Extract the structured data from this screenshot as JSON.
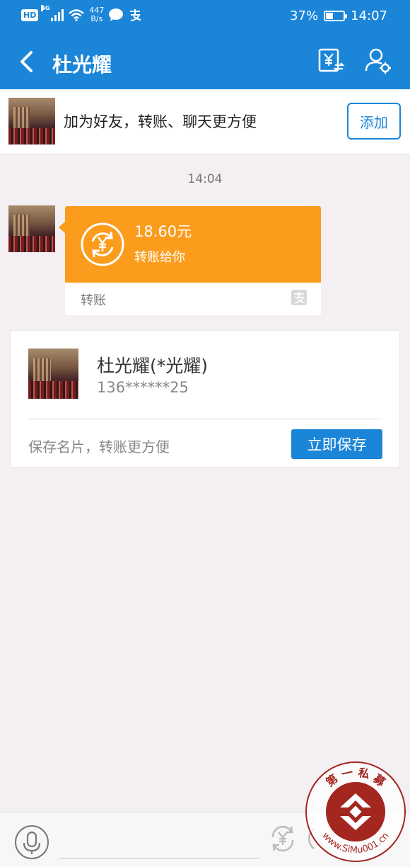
{
  "status_bar": {
    "hd": "HD",
    "network": "4G",
    "speed_value": "447",
    "speed_unit": "B/s",
    "battery": "37%",
    "battery_level": 0.37,
    "time": "14:07"
  },
  "nav": {
    "title": "杜光耀"
  },
  "friend_prompt": {
    "text": "加为好友，转账、聊天更方便",
    "add_label": "添加"
  },
  "chat": {
    "time": "14:04",
    "transfer": {
      "amount": "18.60元",
      "desc": "转账给你",
      "type": "转账"
    }
  },
  "contact_card": {
    "name": "杜光耀(*光耀)",
    "phone": "136******25",
    "hint": "保存名片，转账更方便",
    "save_label": "立即保存"
  },
  "input": {
    "placeholder": ""
  },
  "watermark": {
    "top_text": "第 一 私 募",
    "bottom_text": "www.SiMu001.cn"
  },
  "colors": {
    "primary": "#1b85d8",
    "transfer": "#fc9c1c",
    "background": "#f3eff3",
    "watermark": "#a3261f"
  }
}
